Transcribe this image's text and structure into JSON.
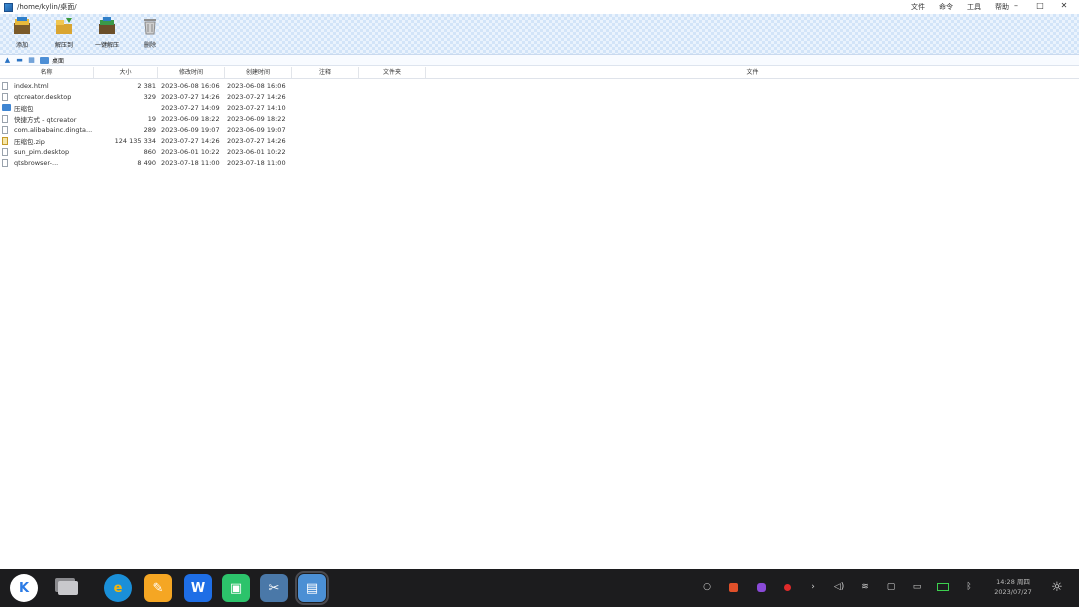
{
  "window": {
    "path": "/home/kylin/桌面/",
    "menus": [
      "文件",
      "命令",
      "工具",
      "帮助"
    ],
    "controls": [
      "–",
      "□",
      "✕"
    ]
  },
  "toolbar": {
    "buttons": [
      {
        "label": "添加",
        "icon": "add-archive-icon"
      },
      {
        "label": "解压到",
        "icon": "extract-to-icon"
      },
      {
        "label": "一键解压",
        "icon": "one-click-extract-icon"
      },
      {
        "label": "删除",
        "icon": "delete-icon"
      }
    ]
  },
  "address": {
    "location": "桌面"
  },
  "columns": [
    "名称",
    "大小",
    "修改时间",
    "创建时间",
    "注释",
    "文件夹",
    "文件"
  ],
  "files": [
    {
      "name": "index.html",
      "size": "2 381",
      "modified": "2023-06-08 16:06",
      "created": "2023-06-08 16:06",
      "type": "file"
    },
    {
      "name": "qtcreator.desktop",
      "size": "329",
      "modified": "2023-07-27 14:26",
      "created": "2023-07-27 14:26",
      "type": "file"
    },
    {
      "name": "压缩包",
      "size": "",
      "modified": "2023-07-27 14:09",
      "created": "2023-07-27 14:10",
      "type": "folder"
    },
    {
      "name": "快捷方式 - qtcreator",
      "size": "19",
      "modified": "2023-06-09 18:22",
      "created": "2023-06-09 18:22",
      "type": "file"
    },
    {
      "name": "com.alibabainc.dingta...",
      "size": "289",
      "modified": "2023-06-09 19:07",
      "created": "2023-06-09 19:07",
      "type": "file"
    },
    {
      "name": "压缩包.zip",
      "size": "124 135 334",
      "modified": "2023-07-27 14:26",
      "created": "2023-07-27 14:26",
      "type": "zip"
    },
    {
      "name": "sun_pim.desktop",
      "size": "860",
      "modified": "2023-06-01 10:22",
      "created": "2023-06-01 10:22",
      "type": "file"
    },
    {
      "name": "qtsbrowser-...",
      "size": "8 490",
      "modified": "2023-07-18 11:00",
      "created": "2023-07-18 11:00",
      "type": "file"
    }
  ],
  "taskbar": {
    "apps": [
      {
        "icon": "start-menu-icon",
        "glyph": "K",
        "color": "#2c7be5"
      },
      {
        "icon": "multitask-view-icon",
        "glyph": "",
        "color": "#8a8a8e"
      },
      {
        "icon": "browser-icon",
        "glyph": "e",
        "color": "#f2b60f"
      },
      {
        "icon": "pencil-app-icon",
        "glyph": "✎",
        "color": "#f0a020"
      },
      {
        "icon": "wps-office-icon",
        "glyph": "W",
        "color": "#1e6ee6"
      },
      {
        "icon": "app-store-icon",
        "glyph": "▣",
        "color": "#2cc36b"
      },
      {
        "icon": "screenshot-tool-icon",
        "glyph": "✂",
        "color": "#4a78a8"
      },
      {
        "icon": "archive-manager-icon",
        "glyph": "▤",
        "color": "#4b8fd4"
      }
    ],
    "clock": {
      "time": "14:28 周四",
      "date": "2023/07/27"
    }
  }
}
